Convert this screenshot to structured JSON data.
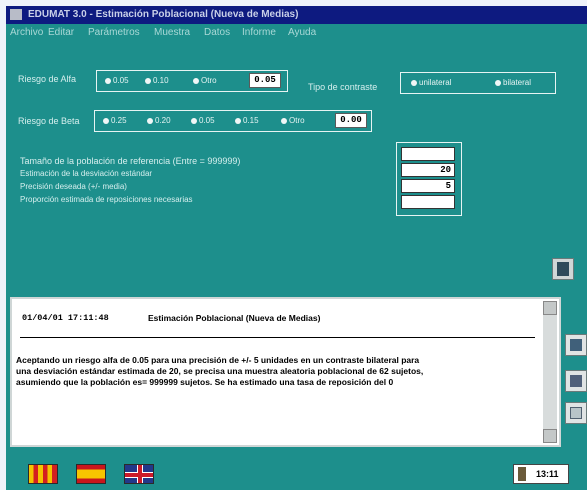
{
  "window": {
    "title": "EDUMAT 3.0 - Estimación Poblacional (Nueva de Medias)"
  },
  "menu": [
    "Archivo",
    "Editar",
    "Parámetros",
    "Muestra",
    "Datos",
    "Informe",
    "Ayuda"
  ],
  "alpha": {
    "label": "Riesgo de Alfa",
    "options": [
      "0.05",
      "0.10",
      "Otro"
    ],
    "value": "0.05"
  },
  "contrast": {
    "label": "Tipo de contraste",
    "options": [
      "unilateral",
      "bilateral"
    ]
  },
  "beta": {
    "label": "Riesgo de Beta",
    "options": [
      "0.25",
      "0.20",
      "0.05",
      "0.15",
      "Otro"
    ],
    "value": "0.00"
  },
  "params": {
    "rows": [
      "Tamaño de la población de referencia (Entre = 999999)",
      "Estimación de la desviación estándar",
      "Precisión deseada (+/- media)",
      "Proporción estimada de reposiciones necesarias"
    ],
    "values": [
      "",
      "20",
      "5",
      ""
    ]
  },
  "report": {
    "date": "01/04/01",
    "time": "17:11:48",
    "heading": "Estimación Poblacional (Nueva de Medias)",
    "lines": [
      "Aceptando un riesgo alfa de 0.05 para una precisión de +/- 5 unidades en un contraste bilateral para",
      "una desviación estándar estimada de 20, se precisa una muestra aleatoria poblacional de 62 sujetos,",
      "asumiendo que la población es= 999999 sujetos.  Se ha estimado una tasa de reposición del 0"
    ]
  },
  "status": {
    "clock": "13:11"
  },
  "colors": {
    "background": "#1d8f8c",
    "titlebar": "#0d1a80",
    "report_bg": "#ffffff"
  },
  "icons": [
    "calculator-icon",
    "printer-icon",
    "save-icon",
    "disk-icon",
    "hourglass-icon"
  ]
}
